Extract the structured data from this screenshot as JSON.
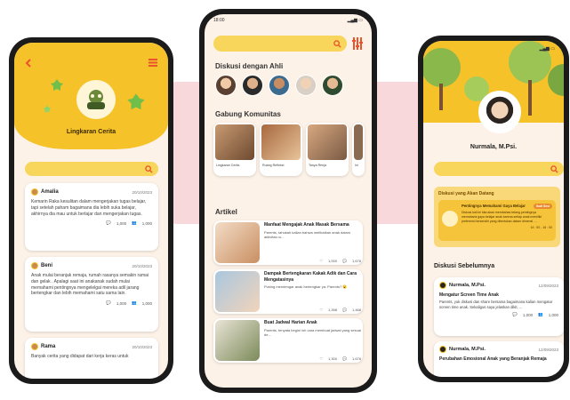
{
  "left_phone": {
    "header": {
      "back_icon": "chevron-left-icon",
      "menu_icon": "hamburger-icon",
      "title": "Lingkaran Cerita"
    },
    "posts": [
      {
        "author": "Amalia",
        "date": "20/10/2023",
        "text": "Kemarin Raka kesulitan dalam mengerjakan tugas belajar, tapi setelah paham bagaimana dia lebih suka belajar, akhirnya dia mau untuk berlajar dan mengerjakan tugas.",
        "comments": "1,000",
        "members": "1,000"
      },
      {
        "author": "Beni",
        "date": "20/10/2023",
        "text": "Anak mulai beranjak remaja, rumah rasanya semakin ramai dan gelak . Apalagi saat ini anakanak sudah mulai memahami pentingnya mengelelgai mereka adil jarang bertengkar dan lebih memahami satu sama lain.",
        "comments": "1,000",
        "members": "1,000"
      },
      {
        "author": "Rama",
        "date": "20/10/2023",
        "text": "Banyak cerita yang didapat dari kerja keras untuk"
      }
    ]
  },
  "center_phone": {
    "status_time": "18:00",
    "section_experts": "Diskusi dengan Ahli",
    "section_community": "Gabung Komunitas",
    "communities": [
      "Lingkaran Cerita",
      "Ruang Refleksi",
      "Tanya Renja",
      "Ini"
    ],
    "section_articles": "Artikel",
    "articles": [
      {
        "title": "Manfaat Mengajak Anak Masak Bersama",
        "desc": "Parents, tahukah kalian bahwa melibatkan anak dalam aktivitas ru...",
        "likes": "1,000",
        "comments": "1,678"
      },
      {
        "title": "Dampak Bertengkaran Kakak Adik dan Cara Mengatasinya",
        "desc": "Pusing mendengar anak bertengkar ya, Parents? 😮",
        "likes": "1,398",
        "comments": "1,468"
      },
      {
        "title": "Buat Jadwal Harian Anak",
        "desc": "Parents, tenyata begini loh cara membuat jadwal yang sesuai de...",
        "likes": "1,300",
        "comments": "1,678"
      }
    ]
  },
  "right_phone": {
    "name": "Nurmala, M.Psi.",
    "upcoming_title": "Diskusi yang Akan Datang",
    "upcoming_event": {
      "title": "Pentingnya Memahami Gaya Belajar",
      "button": "Ikuti Sesi",
      "desc": "Diskusi kali ini kita akan membahas tetang pentingnya memahami gaya belajar anak karena setiap anak memiliki preferensi tersendiri yang ditentukan dalam dimensi ....",
      "time": "14 : 00 - 16 : 00"
    },
    "previous_title": "Diskusi Sebelumnya",
    "discussions": [
      {
        "author": "Nurmala, M.Psi.",
        "date": "12/09/2023",
        "title": "Mengatur Screen Time Anak",
        "desc": "Parents, yuk diskusi dan share bersama bagaimana kalian mengatur screen time anak. Sekaligus saya jelaskan dikit, ...",
        "comments": "1,000",
        "members": "1,000"
      },
      {
        "author": "Nurmala, M.Psi.",
        "date": "12/09/2023",
        "title": "Perubahan Emosional Anak yang Beranjak Remaja"
      }
    ]
  },
  "colors": {
    "accent_yellow": "#f6c22a",
    "search_yellow": "#f8d65c",
    "background_pink": "#f9d8db",
    "screen_bg": "#fdf2e8"
  }
}
